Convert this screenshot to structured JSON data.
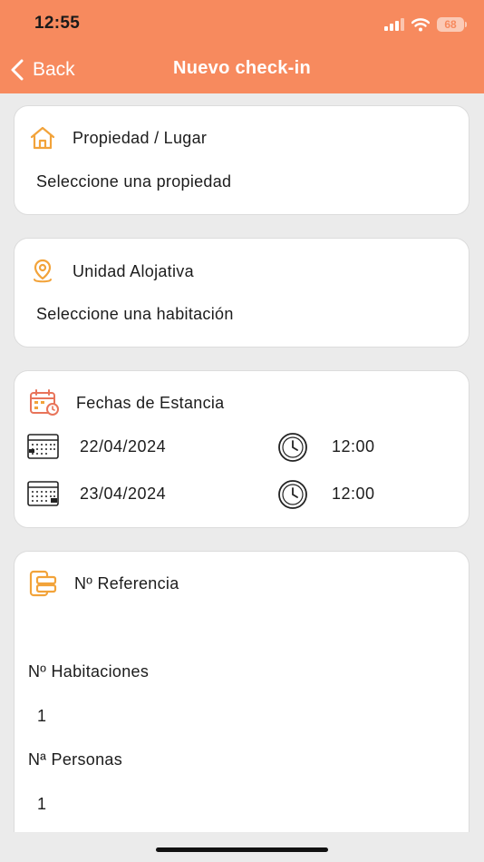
{
  "status_bar": {
    "time": "12:55",
    "battery": "68"
  },
  "nav": {
    "back_label": "Back",
    "title": "Nuevo check-in"
  },
  "property_card": {
    "title": "Propiedad / Lugar",
    "value": "Seleccione una propiedad"
  },
  "unit_card": {
    "title": "Unidad Alojativa",
    "value": "Seleccione una habitación"
  },
  "dates_card": {
    "title": "Fechas de Estancia",
    "rows": [
      {
        "date": "22/04/2024",
        "time": "12:00"
      },
      {
        "date": "23/04/2024",
        "time": "12:00"
      }
    ]
  },
  "details_card": {
    "reference_label": "Nº Referencia",
    "rooms_label": "Nº Habitaciones",
    "rooms_value": "1",
    "people_label": "Nª Personas",
    "people_value": "1"
  },
  "colors": {
    "header": "#f78a5e",
    "icon_orange": "#f2a33a",
    "background": "#ebebeb"
  }
}
